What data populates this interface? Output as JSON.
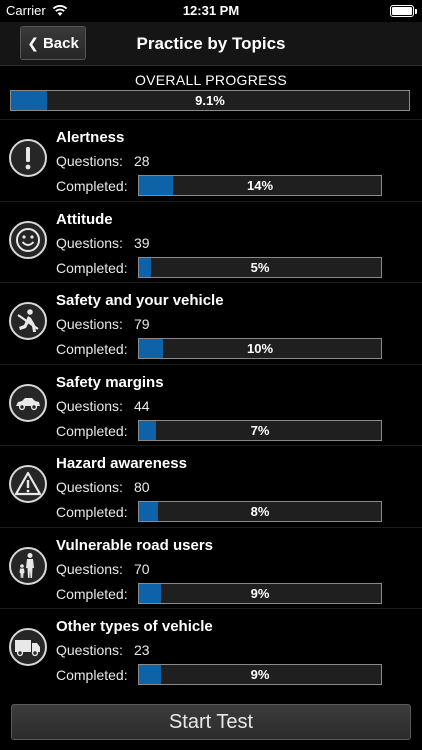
{
  "status_bar": {
    "carrier": "Carrier",
    "time": "12:31 PM"
  },
  "nav": {
    "back_label": "Back",
    "title": "Practice by Topics"
  },
  "overall": {
    "label": "OVERALL PROGRESS",
    "percent_text": "9.1%",
    "fraction": 0.091
  },
  "labels": {
    "questions": "Questions:",
    "completed": "Completed:"
  },
  "topics": [
    {
      "name": "Alertness",
      "questions": "28",
      "percent_text": "14%",
      "fraction": 0.14,
      "icon": "exclamation-icon"
    },
    {
      "name": "Attitude",
      "questions": "39",
      "percent_text": "5%",
      "fraction": 0.05,
      "icon": "smiley-icon"
    },
    {
      "name": "Safety and your vehicle",
      "questions": "79",
      "percent_text": "10%",
      "fraction": 0.1,
      "icon": "seatbelt-icon"
    },
    {
      "name": "Safety margins",
      "questions": "44",
      "percent_text": "7%",
      "fraction": 0.07,
      "icon": "car-icon"
    },
    {
      "name": "Hazard awareness",
      "questions": "80",
      "percent_text": "8%",
      "fraction": 0.08,
      "icon": "warning-triangle-icon"
    },
    {
      "name": "Vulnerable road users",
      "questions": "70",
      "percent_text": "9%",
      "fraction": 0.09,
      "icon": "pedestrians-icon"
    },
    {
      "name": "Other types of vehicle",
      "questions": "23",
      "percent_text": "9%",
      "fraction": 0.09,
      "icon": "truck-icon"
    }
  ],
  "start_button": "Start Test",
  "colors": {
    "progress_fill": "#0d62a8",
    "background": "#000000"
  }
}
